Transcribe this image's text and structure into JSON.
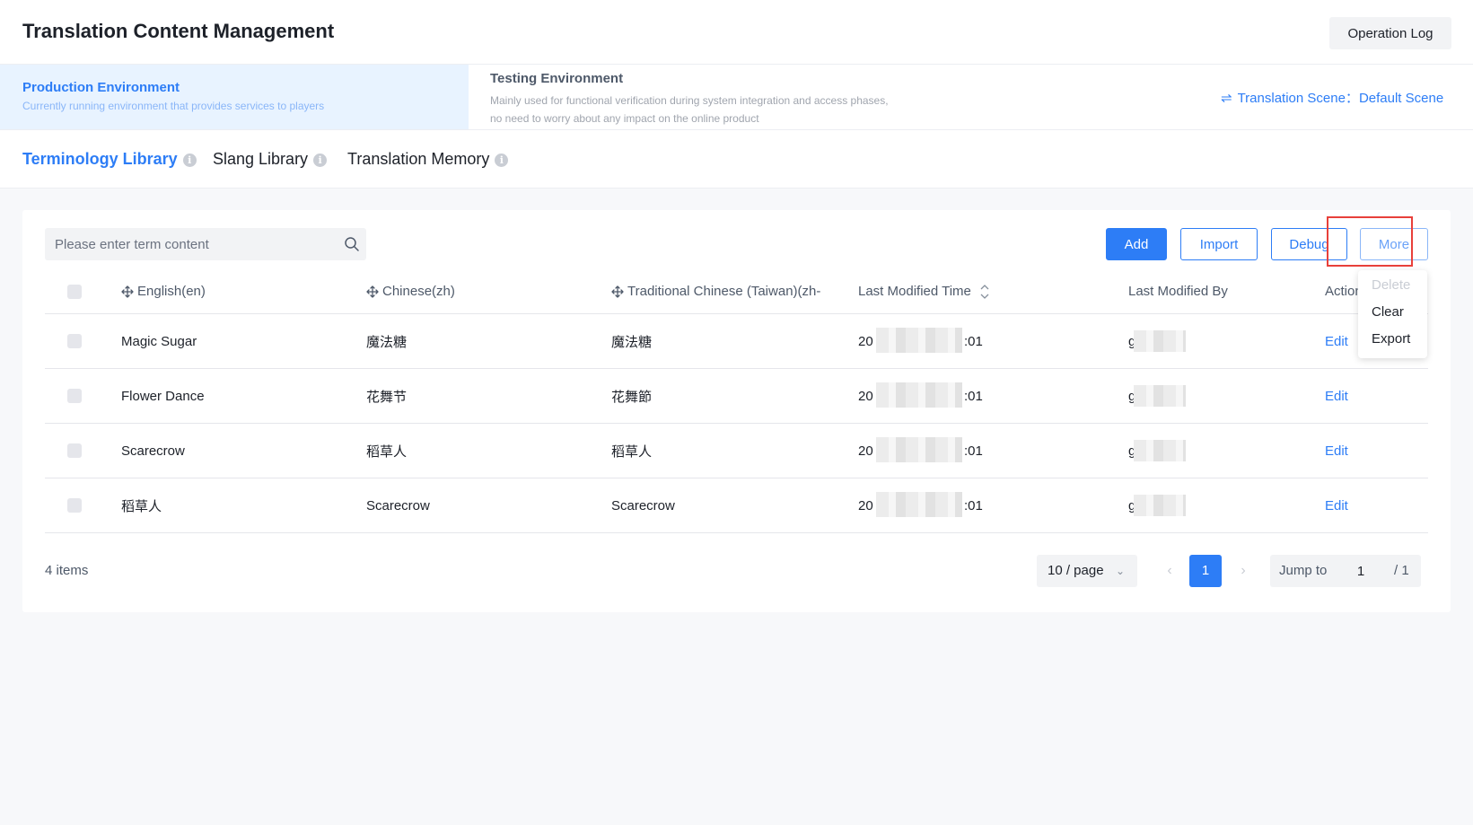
{
  "header": {
    "title": "Translation Content Management",
    "operation_log_label": "Operation Log"
  },
  "environments": {
    "production": {
      "name": "Production Environment",
      "description": "Currently running environment that provides services to players"
    },
    "testing": {
      "name": "Testing Environment",
      "description": "Mainly used for functional verification during system integration and access phases, no need to worry about any impact on the online product"
    },
    "scene_label": "Translation Scene：",
    "scene_value": "Default Scene"
  },
  "library_tabs": [
    {
      "label": "Terminology Library",
      "active": true
    },
    {
      "label": "Slang Library",
      "active": false
    },
    {
      "label": "Translation Memory",
      "active": false
    }
  ],
  "toolbar": {
    "search_placeholder": "Please enter term content",
    "add_label": "Add",
    "import_label": "Import",
    "debug_label": "Debug",
    "more_label": "More"
  },
  "more_menu": [
    {
      "label": "Delete",
      "disabled": true
    },
    {
      "label": "Clear",
      "disabled": false
    },
    {
      "label": "Export",
      "disabled": false
    }
  ],
  "table": {
    "columns": {
      "english": "English(en)",
      "chinese": "Chinese(zh)",
      "traditional": "Traditional Chinese (Taiwan)(zh-",
      "modified_time": "Last Modified Time",
      "modified_by": "Last Modified By",
      "action": "Action"
    },
    "rows": [
      {
        "english": "Magic Sugar",
        "chinese": "魔法糖",
        "traditional": "魔法糖",
        "time_start": "20",
        "time_end": ":01",
        "by_start": "g",
        "action": "Edit"
      },
      {
        "english": "Flower Dance",
        "chinese": "花舞节",
        "traditional": "花舞節",
        "time_start": "20",
        "time_end": ":01",
        "by_start": "g",
        "action": "Edit"
      },
      {
        "english": "Scarecrow",
        "chinese": "稻草人",
        "traditional": "稻草人",
        "time_start": "20",
        "time_end": ":01",
        "by_start": "g",
        "action": "Edit"
      },
      {
        "english": "稻草人",
        "chinese": "Scarecrow",
        "traditional": "Scarecrow",
        "time_start": "20",
        "time_end": ":01",
        "by_start": "g",
        "action": "Edit"
      }
    ]
  },
  "pagination": {
    "total_label": "4 items",
    "page_size": "10 / page",
    "current_page": "1",
    "jump_label": "Jump to",
    "jump_value": "1",
    "total_pages": "/ 1"
  },
  "colors": {
    "accent": "#2d7df6",
    "highlight_border": "#e8403a"
  }
}
